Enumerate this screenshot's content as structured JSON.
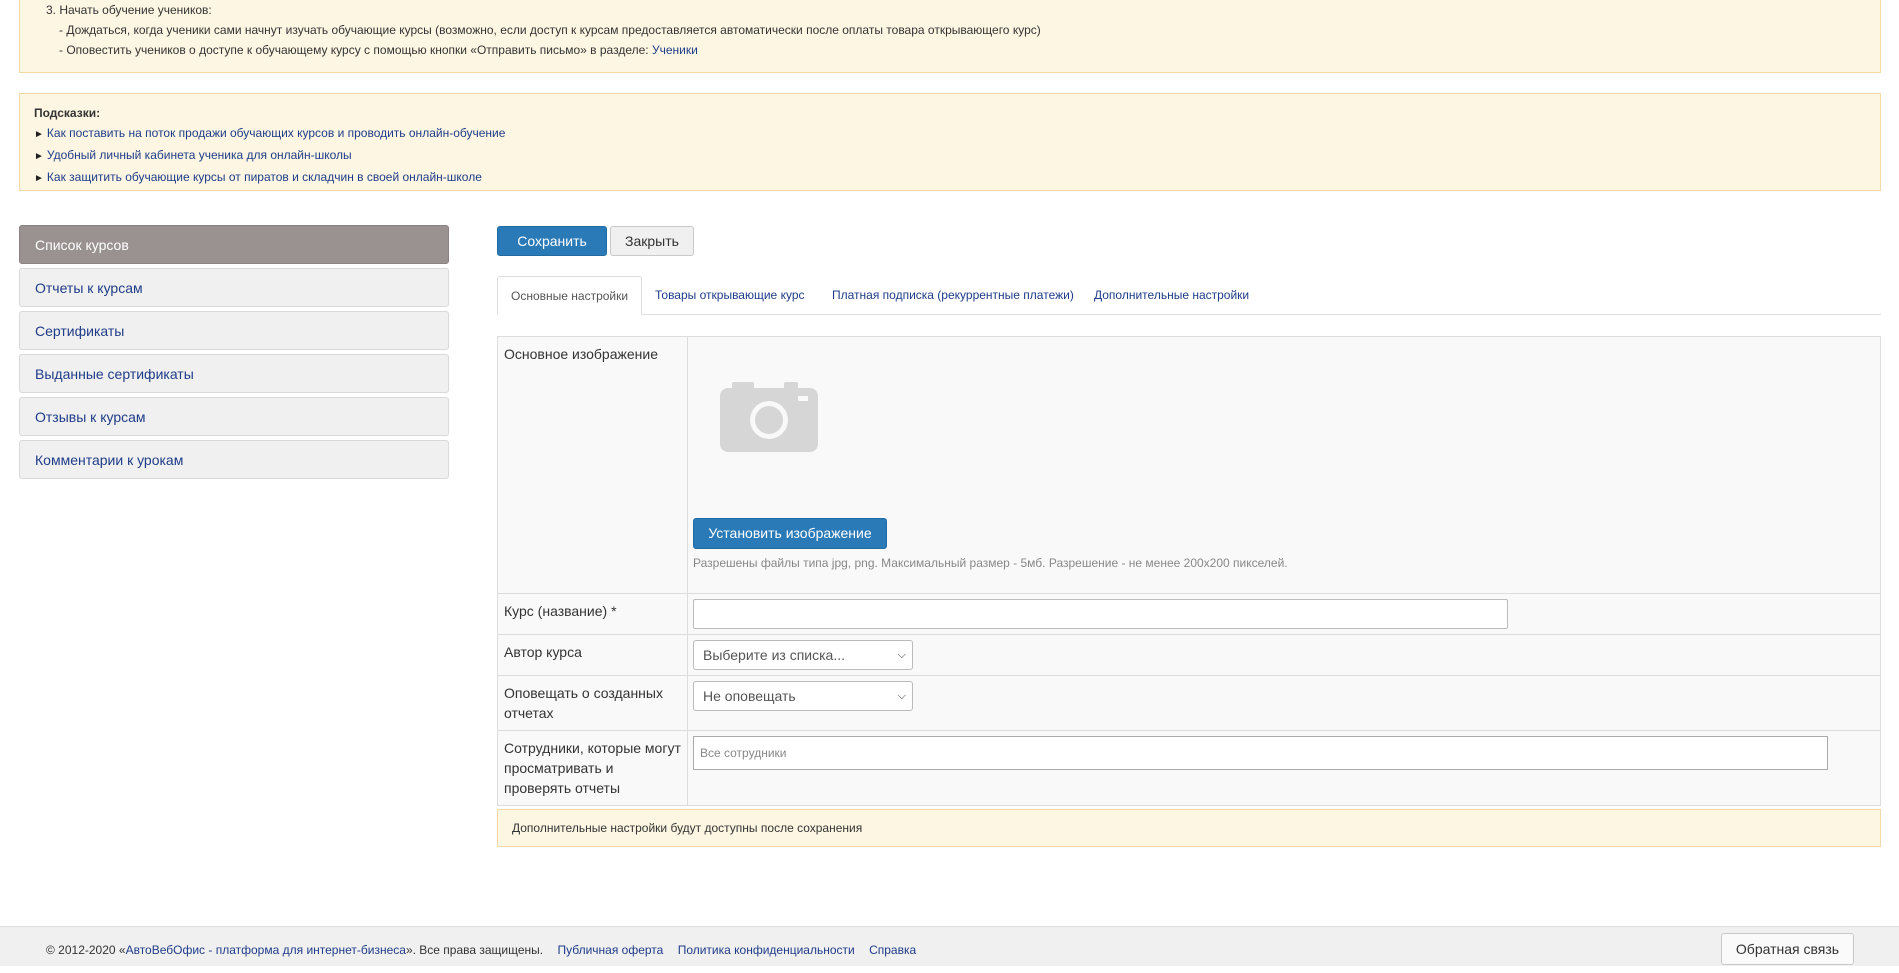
{
  "instructions": {
    "step3": "3. Начать обучение учеников:",
    "line1": "- Дождаться, когда ученики сами начнут изучать обучающие курсы (возможно, если доступ к курсам предоставляется автоматически после оплаты товара открывающего курс)",
    "line2_prefix": "- Оповестить учеников о доступе к обучающему курсу с помощью кнопки «Отправить письмо» в разделе: ",
    "line2_link": "Ученики"
  },
  "hints": {
    "title": "Подсказки:",
    "items": [
      "Как поставить на поток продажи обучающих курсов и проводить онлайн-обучение",
      "Удобный личный кабинета ученика для онлайн-школы",
      "Как защитить обучающие курсы от пиратов и складчин в своей онлайн-школе"
    ]
  },
  "sidebar": {
    "items": [
      {
        "label": "Список курсов",
        "active": true
      },
      {
        "label": "Отчеты к курсам"
      },
      {
        "label": "Сертификаты"
      },
      {
        "label": "Выданные сертификаты"
      },
      {
        "label": "Отзывы к курсам"
      },
      {
        "label": "Комментарии к урокам"
      }
    ]
  },
  "toolbar": {
    "save_label": "Сохранить",
    "close_label": "Закрыть"
  },
  "tabs": [
    {
      "label": "Основные настройки",
      "active": true
    },
    {
      "label": "Товары открывающие курс"
    },
    {
      "label": "Платная подписка (рекуррентные платежи)"
    },
    {
      "label": "Дополнительные настройки"
    }
  ],
  "form": {
    "image_label": "Основное изображение",
    "image_button": "Установить изображение",
    "image_hint": "Разрешены файлы типа jpg, png. Максимальный размер - 5мб. Разрешение - не менее 200x200 пикселей.",
    "course_label": "Курс (название) *",
    "course_value": "",
    "author_label": "Автор курса",
    "author_value": "Выберите из списка...",
    "notify_label": "Оповещать о созданных отчетах",
    "notify_value": "Не оповещать",
    "staff_label": "Сотрудники, которые могут просматривать и проверять отчеты",
    "staff_placeholder": "Все сотрудники"
  },
  "notice": "Дополнительные настройки будут доступны после сохранения",
  "footer": {
    "copyright_prefix": "© 2012-2020 «",
    "brand": "АвтоВебОфис - платформа для интернет-бизнеса",
    "copyright_suffix": "». Все права защищены.",
    "links": [
      "Публичная оферта",
      "Политика конфиденциальности",
      "Справка"
    ],
    "feedback_label": "Обратная связь"
  },
  "colors": {
    "primary": "#2a7ab8",
    "link": "#1f3c88",
    "notice_bg": "#fdf6e3",
    "active_sidebar": "#9a9291"
  },
  "icons": {
    "hint_bullet": "►",
    "camera": "camera-icon"
  }
}
